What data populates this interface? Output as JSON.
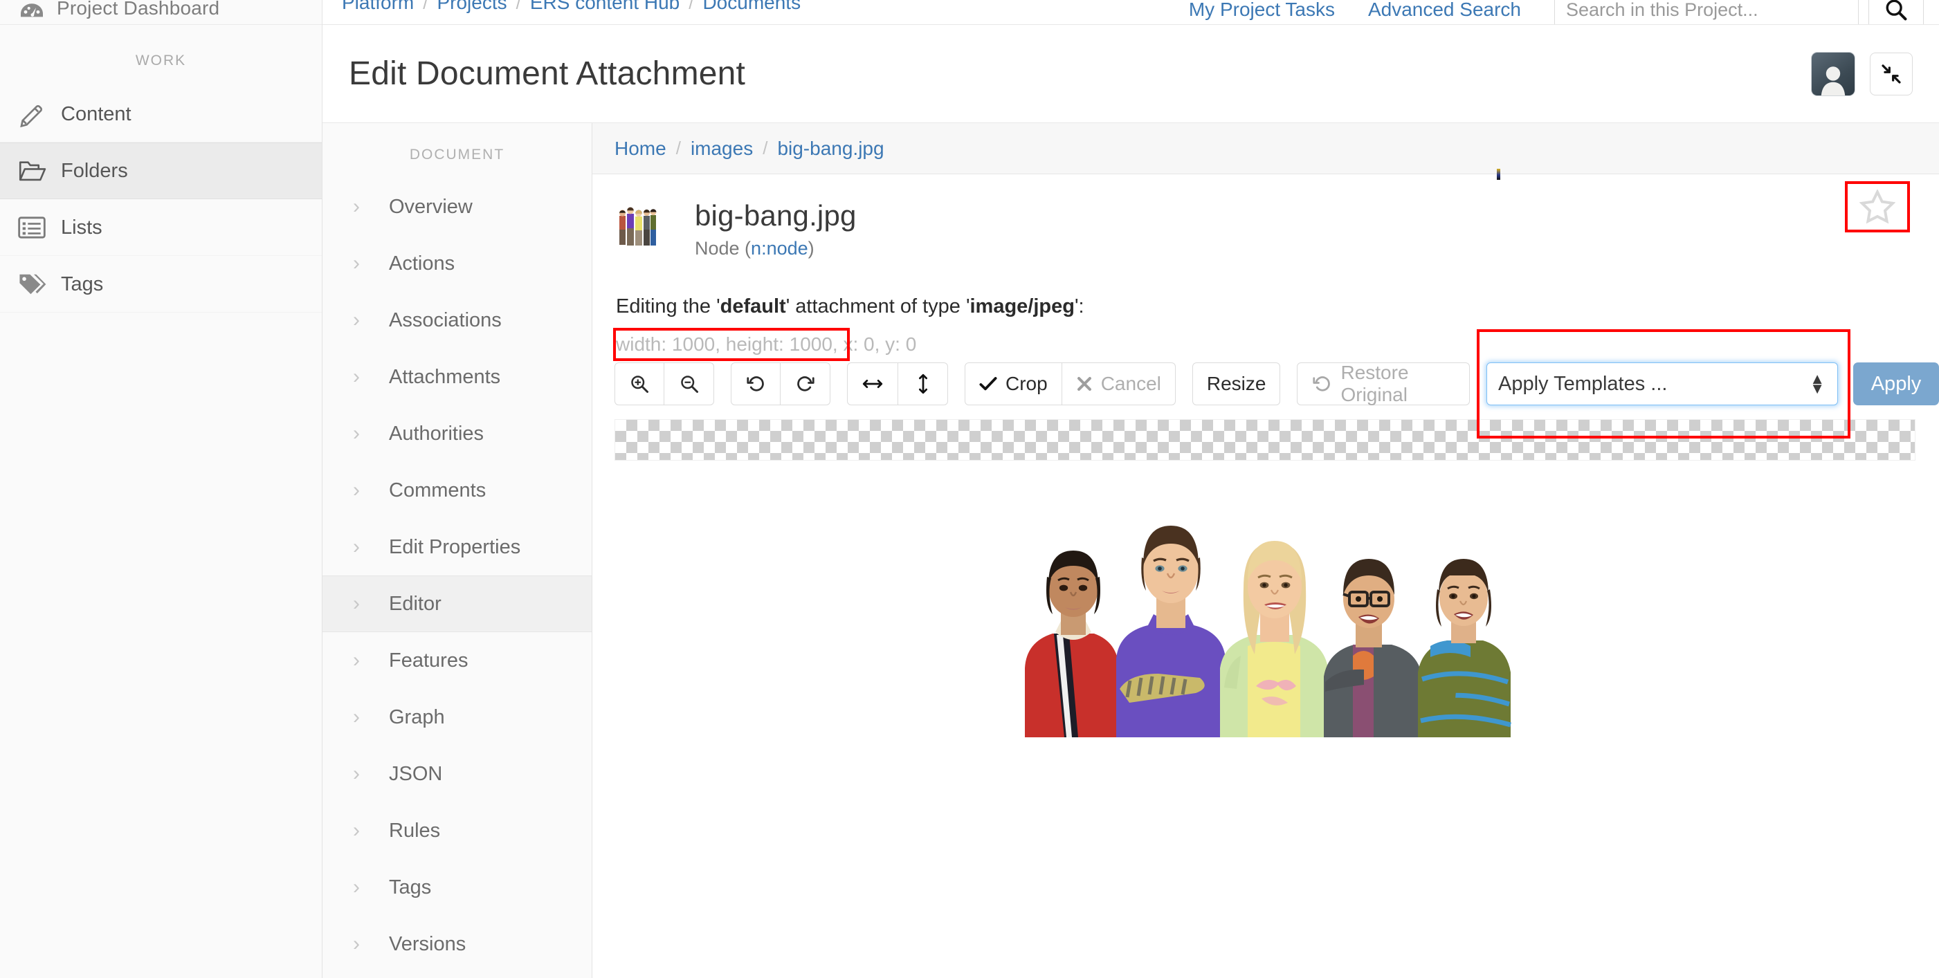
{
  "sidebar": {
    "top_item": {
      "label": "Project Dashboard",
      "icon": "dashboard-icon"
    },
    "section_label": "WORK",
    "items": [
      {
        "label": "Content",
        "icon": "pencil-icon",
        "active": false
      },
      {
        "label": "Folders",
        "icon": "folder-open-icon",
        "active": true
      },
      {
        "label": "Lists",
        "icon": "list-icon",
        "active": false
      },
      {
        "label": "Tags",
        "icon": "tag-icon",
        "active": false
      }
    ]
  },
  "topbar": {
    "breadcrumbs": [
      "Platform",
      "Projects",
      "ERS content Hub",
      "Documents"
    ],
    "separator": "/",
    "links": [
      "My Project Tasks",
      "Advanced Search"
    ],
    "search_placeholder": "Search in this Project...",
    "search_value": "",
    "search_icon": "search-icon"
  },
  "pagehead": {
    "title": "Edit Document Attachment",
    "avatar_icon": "user-avatar-icon",
    "collapse_icon": "collapse-arrows-icon"
  },
  "docnav": {
    "title": "DOCUMENT",
    "chevron": "›",
    "items": [
      {
        "label": "Overview",
        "active": false
      },
      {
        "label": "Actions",
        "active": false
      },
      {
        "label": "Associations",
        "active": false
      },
      {
        "label": "Attachments",
        "active": false
      },
      {
        "label": "Authorities",
        "active": false
      },
      {
        "label": "Comments",
        "active": false
      },
      {
        "label": "Edit Properties",
        "active": false
      },
      {
        "label": "Editor",
        "active": true
      },
      {
        "label": "Features",
        "active": false
      },
      {
        "label": "Graph",
        "active": false
      },
      {
        "label": "JSON",
        "active": false
      },
      {
        "label": "Rules",
        "active": false
      },
      {
        "label": "Tags",
        "active": false
      },
      {
        "label": "Versions",
        "active": false
      }
    ]
  },
  "content": {
    "breadcrumbs": [
      "Home",
      "images",
      "big-bang.jpg"
    ],
    "separator": "/",
    "file": {
      "name": "big-bang.jpg",
      "type_prefix": "Node (",
      "type_link": "n:node",
      "type_suffix": ")",
      "thumbnail_icon": "image-thumbnail"
    },
    "favorite_icon": "star-outline-icon",
    "edit_line": {
      "prefix": "Editing the '",
      "attachment": "default",
      "middle": "' attachment of type '",
      "mime": "image/jpeg",
      "suffix": "':"
    },
    "dimensions": {
      "highlighted": "width: 1000, height: 1000,",
      "rest": " x: 0, y: 0"
    },
    "toolbar": {
      "groups": [
        {
          "buttons": [
            {
              "label": "",
              "icon": "zoom-in-icon",
              "name": "zoom-in-button",
              "disabled": false
            },
            {
              "label": "",
              "icon": "zoom-out-icon",
              "name": "zoom-out-button",
              "disabled": false
            }
          ]
        },
        {
          "buttons": [
            {
              "label": "",
              "icon": "rotate-left-icon",
              "name": "rotate-left-button",
              "disabled": false
            },
            {
              "label": "",
              "icon": "rotate-right-icon",
              "name": "rotate-right-button",
              "disabled": false
            }
          ]
        },
        {
          "buttons": [
            {
              "label": "",
              "icon": "flip-horizontal-icon",
              "name": "flip-horizontal-button",
              "disabled": false
            },
            {
              "label": "",
              "icon": "flip-vertical-icon",
              "name": "flip-vertical-button",
              "disabled": false
            }
          ]
        },
        {
          "buttons": [
            {
              "label": "Crop",
              "icon": "check-icon",
              "name": "crop-button",
              "disabled": false
            },
            {
              "label": "Cancel",
              "icon": "x-icon",
              "name": "cancel-button",
              "disabled": true
            }
          ]
        },
        {
          "buttons": [
            {
              "label": "Resize",
              "icon": "",
              "name": "resize-button",
              "disabled": false
            }
          ]
        },
        {
          "buttons": [
            {
              "label": "Restore Original",
              "icon": "restore-icon",
              "name": "restore-original-button",
              "disabled": true
            }
          ]
        }
      ],
      "template_select": {
        "value": "Apply Templates ...",
        "options": [
          "Apply Templates ..."
        ]
      },
      "apply_label": "Apply"
    }
  },
  "colors": {
    "link": "#3c78b4",
    "highlight_red": "#ff0000",
    "apply_button": "#7ba7cf",
    "focus_blue": "#7fbff5",
    "sidebar_bg": "#fafafa",
    "active_item": "#ebebeb",
    "checker_gray": "#cfcfcf"
  }
}
